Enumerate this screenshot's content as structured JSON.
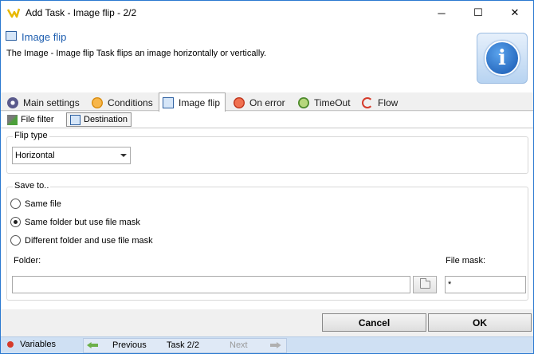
{
  "window": {
    "title": "Add Task - Image flip - 2/2",
    "minimize_glyph": "─",
    "maximize_glyph": "☐",
    "close_glyph": "✕"
  },
  "header": {
    "title": "Image flip",
    "description": "The Image - Image flip Task flips an image horizontally or vertically.",
    "info_glyph": "i"
  },
  "tabs": [
    {
      "label": "Main settings",
      "icon": "gear-icon"
    },
    {
      "label": "Conditions",
      "icon": "conditions-icon"
    },
    {
      "label": "Image flip",
      "icon": "image-icon",
      "active": true
    },
    {
      "label": "On error",
      "icon": "error-icon"
    },
    {
      "label": "TimeOut",
      "icon": "timeout-icon"
    },
    {
      "label": "Flow",
      "icon": "flow-icon"
    }
  ],
  "subtabs": [
    {
      "label": "File filter",
      "icon": "file-filter-icon"
    },
    {
      "label": "Destination",
      "icon": "destination-icon",
      "active": true
    }
  ],
  "flip": {
    "group_label": "Flip type",
    "selected": "Horizontal"
  },
  "save": {
    "group_label": "Save to..",
    "options": [
      {
        "label": "Same file",
        "checked": false
      },
      {
        "label": "Same folder but use file mask",
        "checked": true
      },
      {
        "label": "Different folder and use file mask",
        "checked": false
      }
    ],
    "folder_label": "Folder:",
    "folder_value": "",
    "file_mask_label": "File mask:",
    "file_mask_value": "*"
  },
  "buttons": {
    "cancel": "Cancel",
    "ok": "OK"
  },
  "status": {
    "variables": "Variables",
    "previous": "Previous",
    "task": "Task 2/2",
    "next": "Next"
  },
  "colors": {
    "accent": "#1f5fb0",
    "statusbar": "#cfe0f3"
  }
}
